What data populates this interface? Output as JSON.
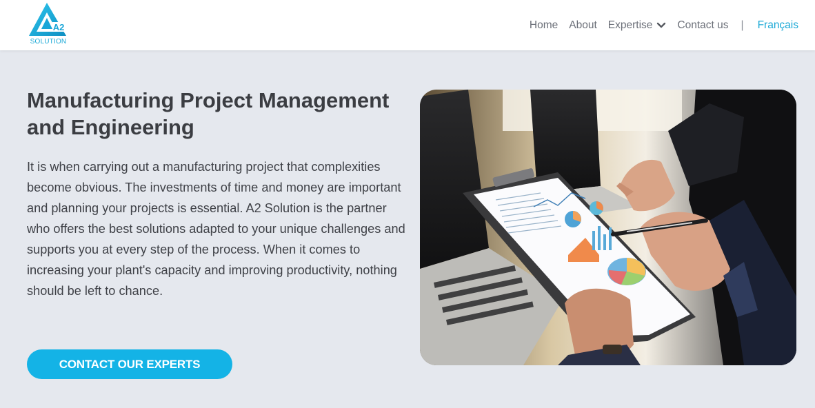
{
  "header": {
    "logo_text": "SOLUTION",
    "logo_mark": "A2",
    "nav": {
      "home": "Home",
      "about": "About",
      "expertise": "Expertise",
      "contact": "Contact us",
      "separator": "|",
      "language": "Français"
    }
  },
  "hero": {
    "title": "Manufacturing Project Management and Engineering",
    "body": "It is when carrying out a manufacturing project that complexities become obvious. The investments of time and money are important and planning your projects is essential. A2 Solution is the partner who offers the best solutions adapted to your unique challenges and supports you at every step of the process. When it comes to increasing your plant's capacity and improving productivity, nothing should be left to chance.",
    "cta_label": "CONTACT OUR EXPERTS",
    "image_alt": "Business people reviewing charts on a clipboard beside laptops"
  },
  "colors": {
    "accent": "#14b3e6",
    "background": "#e5e8ee",
    "text": "#3b3d42"
  }
}
